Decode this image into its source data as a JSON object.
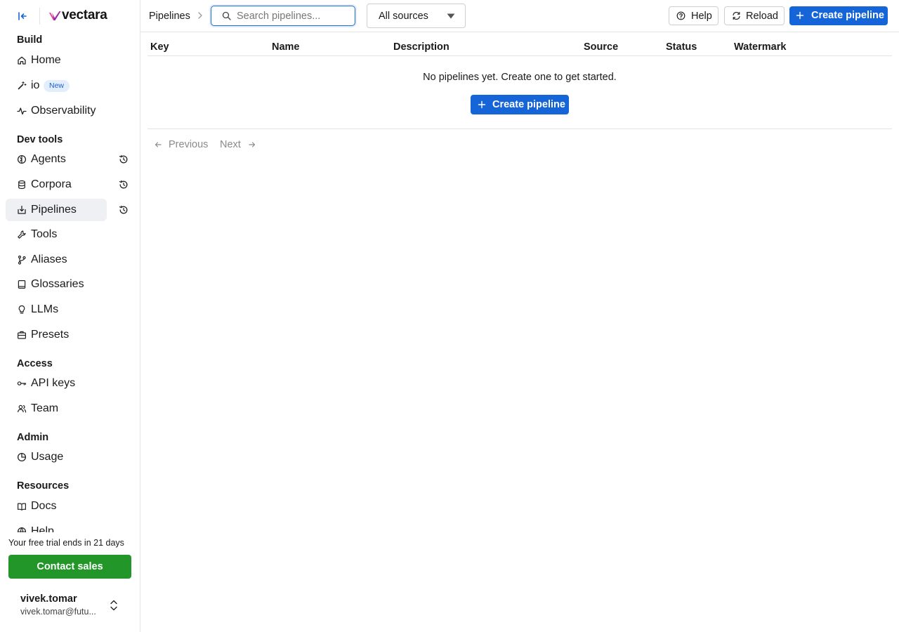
{
  "brand": {
    "logo_text": "vectara",
    "accent": "#7a28c8"
  },
  "sidebar": {
    "sections": [
      {
        "title": "Build",
        "items": [
          {
            "label": "Home",
            "icon": "home-icon"
          },
          {
            "label": "io",
            "icon": "magic-wand-icon",
            "badge": "New"
          },
          {
            "label": "Observability",
            "icon": "activity-icon"
          }
        ]
      },
      {
        "title": "Dev tools",
        "items": [
          {
            "label": "Agents",
            "icon": "agent-icon",
            "history": true
          },
          {
            "label": "Corpora",
            "icon": "database-icon",
            "history": true
          },
          {
            "label": "Pipelines",
            "icon": "pipeline-icon",
            "history": true,
            "active": true
          },
          {
            "label": "Tools",
            "icon": "wrench-icon"
          },
          {
            "label": "Aliases",
            "icon": "git-branch-icon"
          },
          {
            "label": "Glossaries",
            "icon": "book-icon"
          },
          {
            "label": "LLMs",
            "icon": "lightbulb-icon"
          },
          {
            "label": "Presets",
            "icon": "briefcase-icon"
          }
        ]
      },
      {
        "title": "Access",
        "items": [
          {
            "label": "API keys",
            "icon": "key-icon"
          },
          {
            "label": "Team",
            "icon": "team-icon"
          }
        ]
      },
      {
        "title": "Admin",
        "items": [
          {
            "label": "Usage",
            "icon": "pie-chart-icon"
          }
        ]
      },
      {
        "title": "Resources",
        "items": [
          {
            "label": "Docs",
            "icon": "docs-icon"
          },
          {
            "label": "Help",
            "icon": "globe-icon"
          }
        ]
      }
    ],
    "trial_text": "Your free trial ends in 21 days",
    "contact_label": "Contact sales",
    "contact_color": "#23962a",
    "user": {
      "name": "vivek.tomar",
      "email": "vivek.tomar@futu..."
    }
  },
  "topbar": {
    "breadcrumb": "Pipelines",
    "search_placeholder": "Search pipelines...",
    "search_value": "",
    "source_filter": "All sources",
    "help_label": "Help",
    "reload_label": "Reload",
    "create_label": "Create pipeline",
    "primary_color": "#1565d8"
  },
  "table": {
    "columns": [
      "Key",
      "Name",
      "Description",
      "Source",
      "Status",
      "Watermark"
    ],
    "rows": [],
    "empty_message": "No pipelines yet. Create one to get started.",
    "create_label": "Create pipeline"
  },
  "pagination": {
    "prev_label": "Previous",
    "next_label": "Next"
  }
}
